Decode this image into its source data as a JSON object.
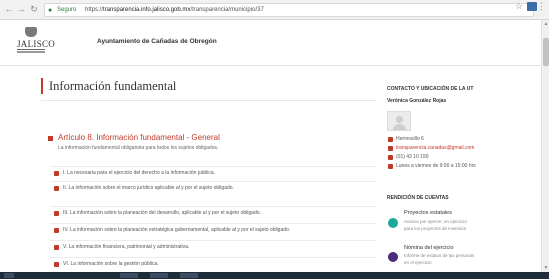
{
  "browser": {
    "back_icon": "back-arrow-icon",
    "forward_icon": "forward-arrow-icon",
    "reload_icon": "reload-icon",
    "secure_label": "Seguro",
    "url_prefix": "https://",
    "url_domain": "transparencia.info.jalisco.gob.mx",
    "url_path": "/transparencia/municipio/37",
    "star_icon": "bookmark-star-icon",
    "menu_icon": "menu-dots-icon"
  },
  "header": {
    "logo_text": "JALISCO",
    "site_title": "Ayuntamiento de Cañadas de Obregón"
  },
  "main": {
    "title": "Información fundamental",
    "section_title": "Artículo 8. Información fundamental - General",
    "section_subtitle": "La información fundamental obligatoria para todos los sujetos obligados.",
    "items": [
      "I. La necesaria para el ejercicio del derecho a la información pública.",
      "II. La información sobre el marco jurídico aplicable al y por el sujeto obligado.",
      "III. La información sobre la planeación del desarrollo, aplicable al y por el sujeto obligado.",
      "IV. La información sobre la planeación estratégica gubernamental, aplicable al y por el sujeto obligado.",
      "V. La información financiera, patrimonial y administrativa.",
      "VI. La información sobre la gestión pública."
    ]
  },
  "sidebar": {
    "contact_heading": "CONTACTO Y UBICACIÓN DE LA UT",
    "contact_name": "Verónica González Rojas",
    "address": "Hermosillo 6",
    "email": "transparencia.canadas@gmail.com",
    "phone": "(01) 43 10 150",
    "hours": "Lunes a viernes de 9:00 a 15:00 hrs",
    "rc_heading": "RENDICIÓN DE CUENTAS",
    "rc_items": [
      {
        "title": "Proyectos estatales",
        "subtitle": "Avance por ejercer, en ejercicio",
        "subtitle2": "para los proyectos de inversión"
      },
      {
        "title": "Nómina del ejercicio",
        "subtitle": "Informe de estatus de las personas",
        "subtitle2": "en el ejercicio"
      }
    ]
  },
  "colors": {
    "accent": "#c0392b",
    "teal": "#1aa89a",
    "purple": "#4a2c7a"
  }
}
